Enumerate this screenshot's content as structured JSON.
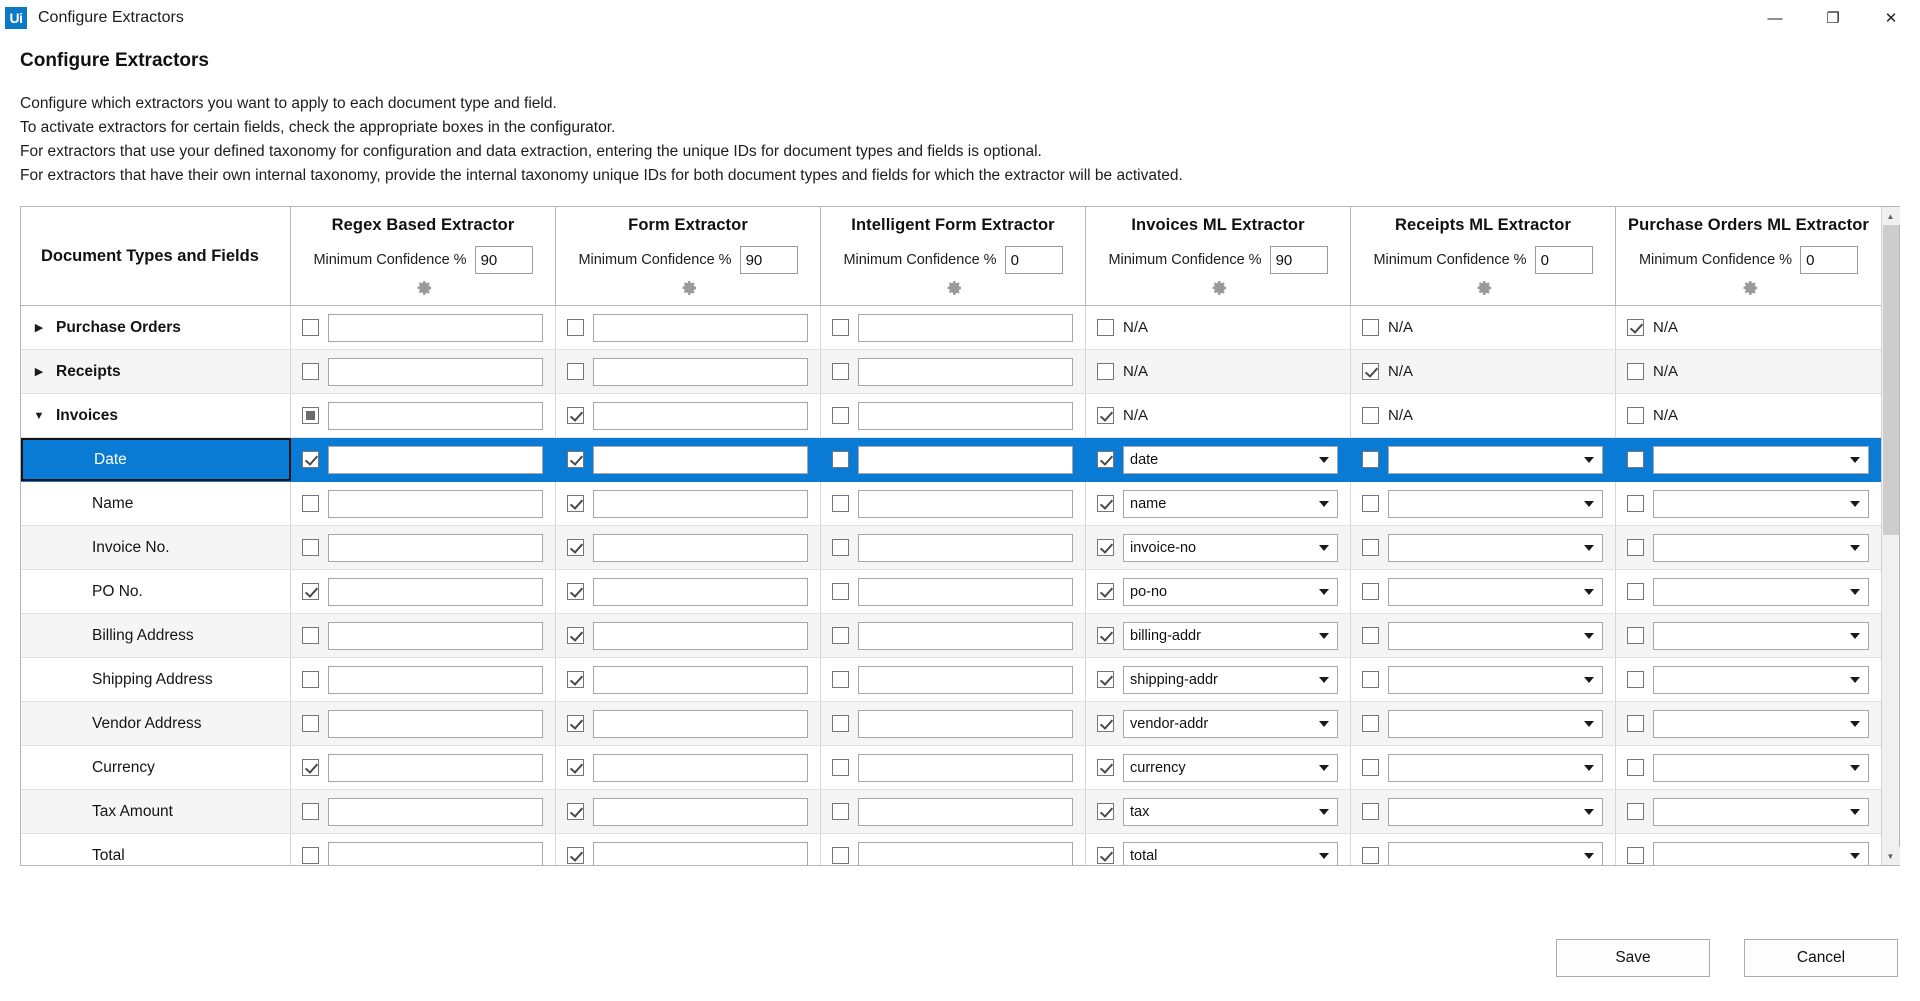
{
  "window": {
    "logo_text": "Ui",
    "title": "Configure Extractors",
    "minimize_label": "—",
    "restore_label": "❐",
    "close_label": "✕"
  },
  "page": {
    "title": "Configure Extractors",
    "description": [
      "Configure which extractors you want to apply to each document type and field.",
      "To activate extractors for certain fields, check the appropriate boxes in the configurator.",
      "For extractors that use your defined taxonomy for configuration and data extraction, entering the unique IDs for document types and fields is optional.",
      "For extractors that have their own internal taxonomy, provide the internal taxonomy unique IDs for both document types and fields for which the extractor will be activated."
    ]
  },
  "grid": {
    "first_column_header": "Document Types and Fields",
    "confidence_label": "Minimum Confidence %",
    "gear_icon": "gear-icon",
    "na_text": "N/A",
    "columns": [
      {
        "title": "Regex Based Extractor",
        "confidence": "90",
        "kind": "text"
      },
      {
        "title": "Form Extractor",
        "confidence": "90",
        "kind": "text"
      },
      {
        "title": "Intelligent Form Extractor",
        "confidence": "0",
        "kind": "text"
      },
      {
        "title": "Invoices ML Extractor",
        "confidence": "90",
        "kind": "mixed"
      },
      {
        "title": "Receipts ML Extractor",
        "confidence": "0",
        "kind": "mixed"
      },
      {
        "title": "Purchase Orders ML Extractor",
        "confidence": "0",
        "kind": "mixed"
      }
    ],
    "rows": [
      {
        "label": "Purchase Orders",
        "type": "group",
        "expanded": false,
        "twisty": "▶",
        "selected": false,
        "alt": false,
        "cells": [
          {
            "checked": "none",
            "control": "text",
            "value": ""
          },
          {
            "checked": "none",
            "control": "text",
            "value": ""
          },
          {
            "checked": "none",
            "control": "text",
            "value": ""
          },
          {
            "checked": "none",
            "control": "na",
            "value": "N/A"
          },
          {
            "checked": "none",
            "control": "na",
            "value": "N/A"
          },
          {
            "checked": "checked",
            "control": "na",
            "value": "N/A"
          }
        ]
      },
      {
        "label": "Receipts",
        "type": "group",
        "expanded": false,
        "twisty": "▶",
        "selected": false,
        "alt": true,
        "cells": [
          {
            "checked": "none",
            "control": "text",
            "value": ""
          },
          {
            "checked": "none",
            "control": "text",
            "value": ""
          },
          {
            "checked": "none",
            "control": "text",
            "value": ""
          },
          {
            "checked": "none",
            "control": "na",
            "value": "N/A"
          },
          {
            "checked": "checked",
            "control": "na",
            "value": "N/A"
          },
          {
            "checked": "none",
            "control": "na",
            "value": "N/A"
          }
        ]
      },
      {
        "label": "Invoices",
        "type": "group",
        "expanded": true,
        "twisty": "▼",
        "selected": false,
        "alt": false,
        "cells": [
          {
            "checked": "partial",
            "control": "text",
            "value": ""
          },
          {
            "checked": "checked",
            "control": "text",
            "value": ""
          },
          {
            "checked": "none",
            "control": "text",
            "value": ""
          },
          {
            "checked": "checked",
            "control": "na",
            "value": "N/A"
          },
          {
            "checked": "none",
            "control": "na",
            "value": "N/A"
          },
          {
            "checked": "none",
            "control": "na",
            "value": "N/A"
          }
        ]
      },
      {
        "label": "Date",
        "type": "field",
        "expanded": false,
        "twisty": "",
        "selected": true,
        "alt": false,
        "cells": [
          {
            "checked": "checked",
            "control": "text",
            "value": ""
          },
          {
            "checked": "checked",
            "control": "text",
            "value": ""
          },
          {
            "checked": "none",
            "control": "text",
            "value": ""
          },
          {
            "checked": "checked",
            "control": "combo",
            "value": "date"
          },
          {
            "checked": "none",
            "control": "combo",
            "value": ""
          },
          {
            "checked": "none",
            "control": "combo",
            "value": ""
          }
        ]
      },
      {
        "label": "Name",
        "type": "field",
        "expanded": false,
        "twisty": "",
        "selected": false,
        "alt": false,
        "cells": [
          {
            "checked": "none",
            "control": "text",
            "value": ""
          },
          {
            "checked": "checked",
            "control": "text",
            "value": ""
          },
          {
            "checked": "none",
            "control": "text",
            "value": ""
          },
          {
            "checked": "checked",
            "control": "combo",
            "value": "name"
          },
          {
            "checked": "none",
            "control": "combo",
            "value": ""
          },
          {
            "checked": "none",
            "control": "combo",
            "value": ""
          }
        ]
      },
      {
        "label": "Invoice No.",
        "type": "field",
        "expanded": false,
        "twisty": "",
        "selected": false,
        "alt": true,
        "cells": [
          {
            "checked": "none",
            "control": "text",
            "value": ""
          },
          {
            "checked": "checked",
            "control": "text",
            "value": ""
          },
          {
            "checked": "none",
            "control": "text",
            "value": ""
          },
          {
            "checked": "checked",
            "control": "combo",
            "value": "invoice-no"
          },
          {
            "checked": "none",
            "control": "combo",
            "value": ""
          },
          {
            "checked": "none",
            "control": "combo",
            "value": ""
          }
        ]
      },
      {
        "label": "PO No.",
        "type": "field",
        "expanded": false,
        "twisty": "",
        "selected": false,
        "alt": false,
        "cells": [
          {
            "checked": "checked",
            "control": "text",
            "value": ""
          },
          {
            "checked": "checked",
            "control": "text",
            "value": ""
          },
          {
            "checked": "none",
            "control": "text",
            "value": ""
          },
          {
            "checked": "checked",
            "control": "combo",
            "value": "po-no"
          },
          {
            "checked": "none",
            "control": "combo",
            "value": ""
          },
          {
            "checked": "none",
            "control": "combo",
            "value": ""
          }
        ]
      },
      {
        "label": "Billing Address",
        "type": "field",
        "expanded": false,
        "twisty": "",
        "selected": false,
        "alt": true,
        "cells": [
          {
            "checked": "none",
            "control": "text",
            "value": ""
          },
          {
            "checked": "checked",
            "control": "text",
            "value": ""
          },
          {
            "checked": "none",
            "control": "text",
            "value": ""
          },
          {
            "checked": "checked",
            "control": "combo",
            "value": "billing-addr"
          },
          {
            "checked": "none",
            "control": "combo",
            "value": ""
          },
          {
            "checked": "none",
            "control": "combo",
            "value": ""
          }
        ]
      },
      {
        "label": "Shipping Address",
        "type": "field",
        "expanded": false,
        "twisty": "",
        "selected": false,
        "alt": false,
        "cells": [
          {
            "checked": "none",
            "control": "text",
            "value": ""
          },
          {
            "checked": "checked",
            "control": "text",
            "value": ""
          },
          {
            "checked": "none",
            "control": "text",
            "value": ""
          },
          {
            "checked": "checked",
            "control": "combo",
            "value": "shipping-addr"
          },
          {
            "checked": "none",
            "control": "combo",
            "value": ""
          },
          {
            "checked": "none",
            "control": "combo",
            "value": ""
          }
        ]
      },
      {
        "label": "Vendor Address",
        "type": "field",
        "expanded": false,
        "twisty": "",
        "selected": false,
        "alt": true,
        "cells": [
          {
            "checked": "none",
            "control": "text",
            "value": ""
          },
          {
            "checked": "checked",
            "control": "text",
            "value": ""
          },
          {
            "checked": "none",
            "control": "text",
            "value": ""
          },
          {
            "checked": "checked",
            "control": "combo",
            "value": "vendor-addr"
          },
          {
            "checked": "none",
            "control": "combo",
            "value": ""
          },
          {
            "checked": "none",
            "control": "combo",
            "value": ""
          }
        ]
      },
      {
        "label": "Currency",
        "type": "field",
        "expanded": false,
        "twisty": "",
        "selected": false,
        "alt": false,
        "cells": [
          {
            "checked": "checked",
            "control": "text",
            "value": ""
          },
          {
            "checked": "checked",
            "control": "text",
            "value": ""
          },
          {
            "checked": "none",
            "control": "text",
            "value": ""
          },
          {
            "checked": "checked",
            "control": "combo",
            "value": "currency"
          },
          {
            "checked": "none",
            "control": "combo",
            "value": ""
          },
          {
            "checked": "none",
            "control": "combo",
            "value": ""
          }
        ]
      },
      {
        "label": "Tax Amount",
        "type": "field",
        "expanded": false,
        "twisty": "",
        "selected": false,
        "alt": true,
        "cells": [
          {
            "checked": "none",
            "control": "text",
            "value": ""
          },
          {
            "checked": "checked",
            "control": "text",
            "value": ""
          },
          {
            "checked": "none",
            "control": "text",
            "value": ""
          },
          {
            "checked": "checked",
            "control": "combo",
            "value": "tax"
          },
          {
            "checked": "none",
            "control": "combo",
            "value": ""
          },
          {
            "checked": "none",
            "control": "combo",
            "value": ""
          }
        ]
      },
      {
        "label": "Total",
        "type": "field",
        "expanded": false,
        "twisty": "",
        "selected": false,
        "alt": false,
        "cells": [
          {
            "checked": "none",
            "control": "text",
            "value": ""
          },
          {
            "checked": "checked",
            "control": "text",
            "value": ""
          },
          {
            "checked": "none",
            "control": "text",
            "value": ""
          },
          {
            "checked": "checked",
            "control": "combo",
            "value": "total"
          },
          {
            "checked": "none",
            "control": "combo",
            "value": ""
          },
          {
            "checked": "none",
            "control": "combo",
            "value": ""
          }
        ]
      }
    ],
    "scrollbar": {
      "up_arrow": "▲",
      "down_arrow": "▼"
    }
  },
  "footer": {
    "save_label": "Save",
    "cancel_label": "Cancel"
  },
  "colors": {
    "accent": "#0a7bd4",
    "brand": "#0b7ac6",
    "border": "#b5b5b5",
    "alt_row": "#f5f5f5"
  }
}
